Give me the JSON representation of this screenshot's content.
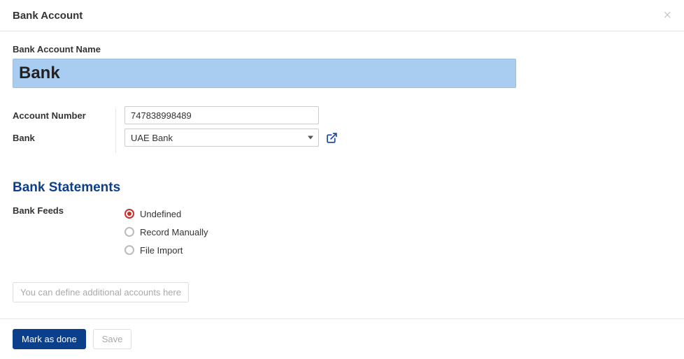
{
  "header": {
    "title": "Bank Account"
  },
  "fields": {
    "name_label": "Bank Account Name",
    "name_value": "Bank",
    "account_number_label": "Account Number",
    "account_number_value": "747838998489",
    "bank_label": "Bank",
    "bank_value": "UAE Bank"
  },
  "statements": {
    "title": "Bank Statements",
    "feeds_label": "Bank Feeds",
    "options": {
      "undefined": "Undefined",
      "record_manually": "Record Manually",
      "file_import": "File Import"
    },
    "selected": "undefined"
  },
  "additional_accounts_label": "You can define additional accounts here",
  "footer": {
    "mark_done": "Mark as done",
    "save": "Save"
  }
}
